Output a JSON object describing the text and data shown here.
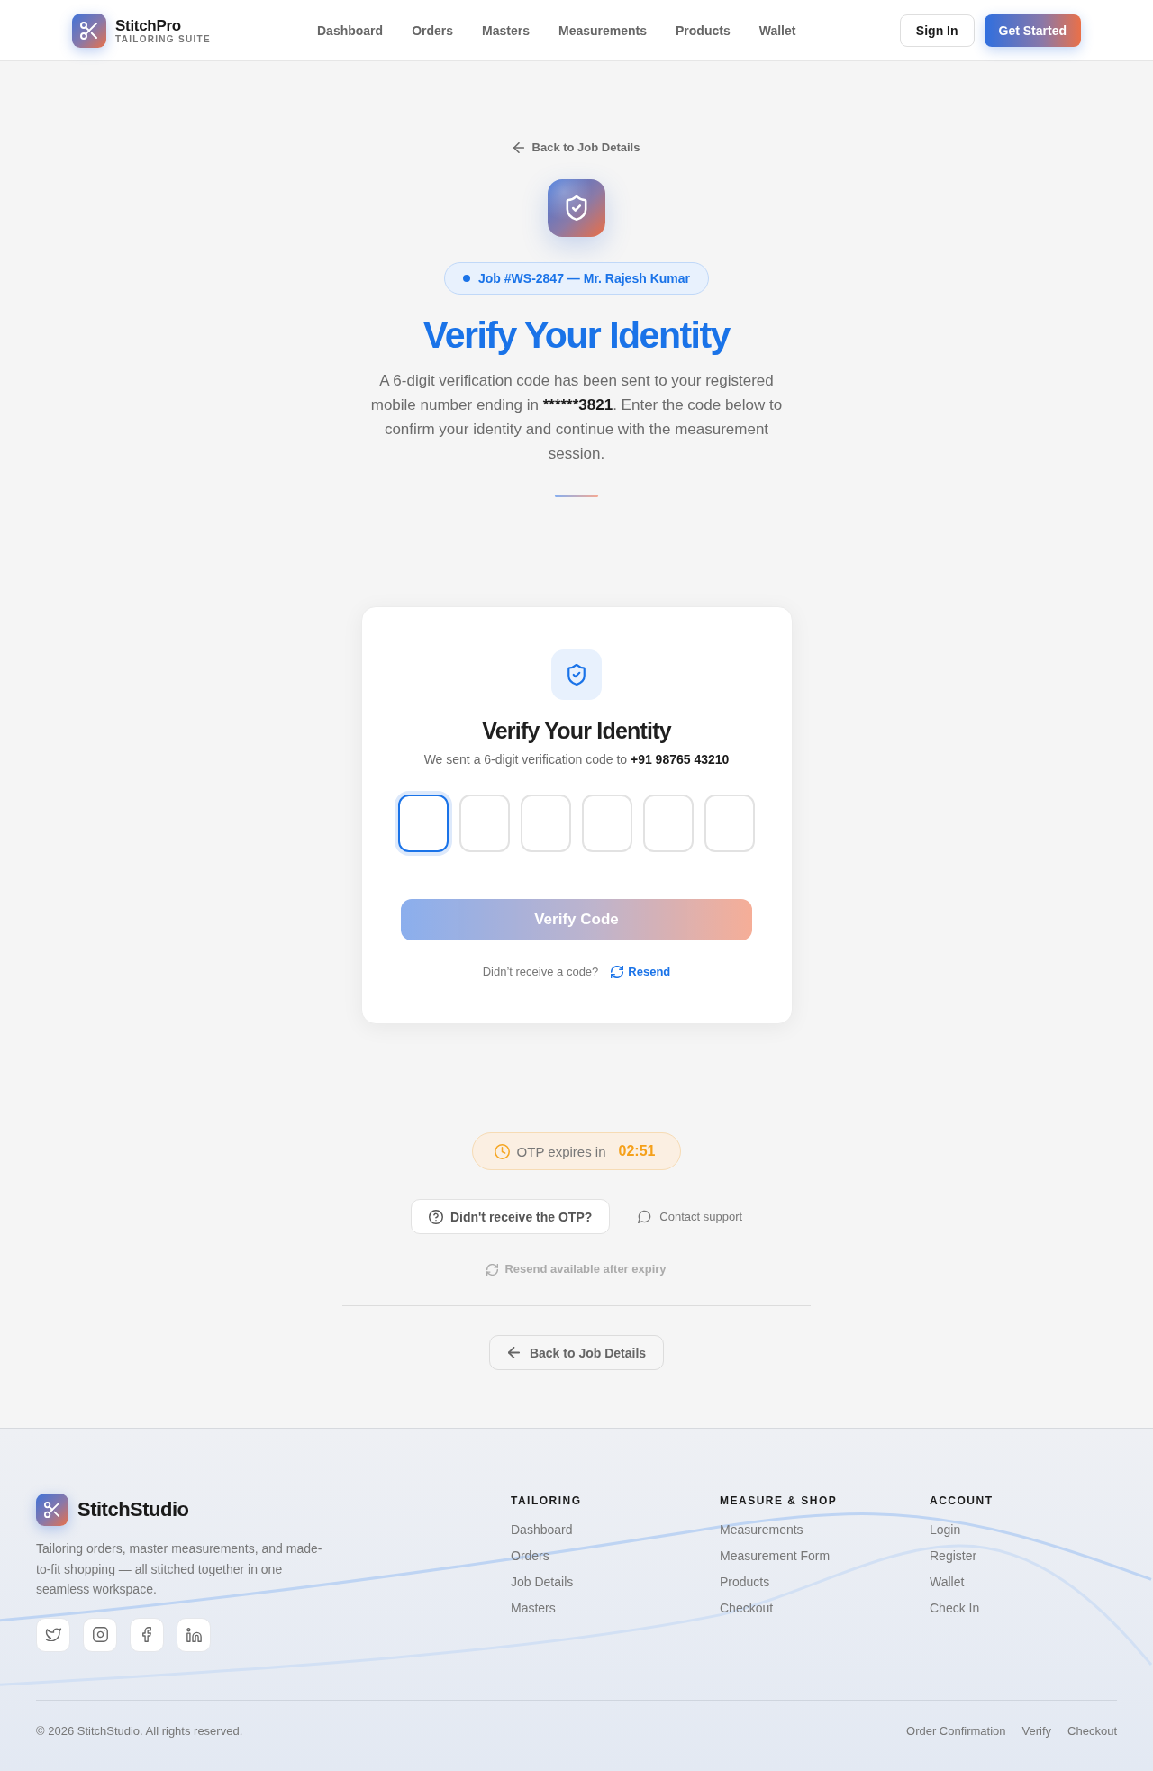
{
  "header": {
    "brand": {
      "name": "StitchPro",
      "tagline": "TAILORING SUITE"
    },
    "nav": [
      "Dashboard",
      "Orders",
      "Masters",
      "Measurements",
      "Products",
      "Wallet"
    ],
    "actions": [
      {
        "label": "Sign In",
        "kind": "outline"
      },
      {
        "label": "Get Started",
        "kind": "primary"
      }
    ]
  },
  "hero": {
    "back_link": "Back to Job Details",
    "badge": "Job #WS-2847 — Mr. Rajesh Kumar",
    "title": "Verify Your Identity",
    "description": {
      "before": "A 6-digit verification code has been sent to your registered mobile number ending in ",
      "highlight": "******3821",
      "after": ". Enter the code below to confirm your identity and continue with the measurement session."
    }
  },
  "card": {
    "title": "Verify Your Identity",
    "subtitle": "We sent a 6-digit verification code to **+91 98765 43210**",
    "otp_boxes": [
      {
        "focused": true
      },
      {
        "focused": false
      },
      {
        "focused": false
      },
      {
        "focused": false
      },
      {
        "focused": false
      },
      {
        "focused": false
      }
    ],
    "verify_button": {
      "label": "Verify Code",
      "disabled": true
    },
    "resend_prompt": "Didn’t receive a code?",
    "resend_link": "Resend"
  },
  "expiry": {
    "label": "OTP expires in",
    "time": "02:51"
  },
  "help_actions": [
    {
      "label": "Didn't receive the OTP?",
      "kind": "outline"
    },
    {
      "label": "Contact support",
      "kind": "link"
    }
  ],
  "resend_note": {
    "label": "Resend available after expiry",
    "disabled": true
  },
  "back_button": "Back to Job Details",
  "footer": {
    "brand": "StitchStudio",
    "description": "Tailoring orders, master measurements, and made-to-fit shopping — all stitched together in one seamless workspace.",
    "social": [
      {
        "kind": "twitter"
      },
      {
        "kind": "instagram"
      },
      {
        "kind": "facebook"
      },
      {
        "kind": "linkedin"
      }
    ],
    "columns": [
      {
        "title": "TAILORING",
        "links": [
          "Dashboard",
          "Orders",
          "Job Details",
          "Masters"
        ]
      },
      {
        "title": "MEASURE & SHOP",
        "links": [
          "Measurements",
          "Measurement Form",
          "Products",
          "Checkout"
        ]
      },
      {
        "title": "ACCOUNT",
        "links": [
          "Login",
          "Register",
          "Wallet",
          "Check In"
        ]
      }
    ],
    "copyright": "© 2026 StitchStudio. All rights reserved.",
    "legal_links": [
      "Order Confirmation",
      "Verify",
      "Checkout"
    ]
  }
}
